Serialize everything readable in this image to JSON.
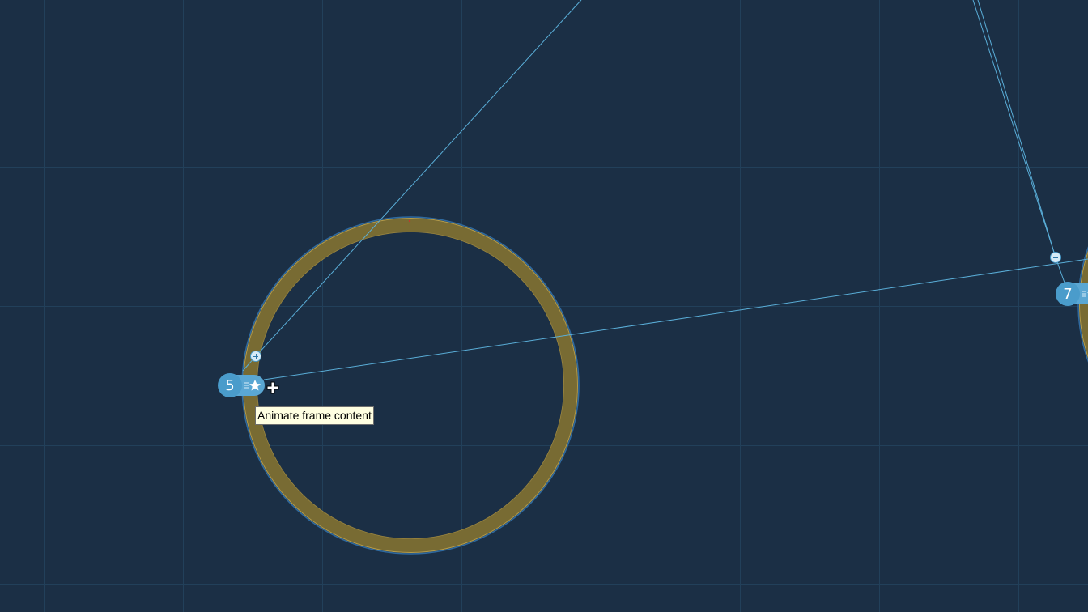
{
  "canvas": {
    "background": "#1b2f45",
    "grid_color": "#22405a",
    "path_color": "#5aaed8",
    "ring_color": "#786b33",
    "ring_edge_color": "#b59c4a",
    "accent": "#4a9ccb"
  },
  "frames": [
    {
      "number": "5",
      "icon": "animate-star-icon"
    },
    {
      "number": "7",
      "icon": "animate-star-icon"
    }
  ],
  "tooltip": {
    "text": "Animate frame content"
  },
  "cursor": {
    "icon": "move-cursor-icon"
  }
}
